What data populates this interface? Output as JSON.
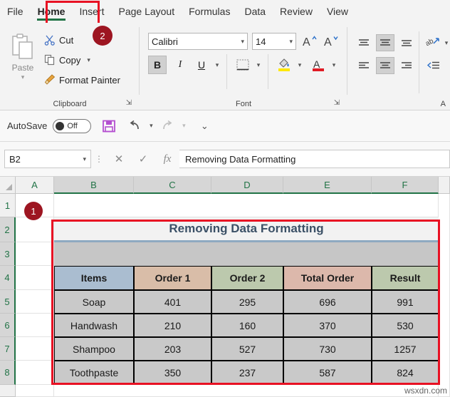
{
  "tabs": [
    {
      "label": "File",
      "active": false
    },
    {
      "label": "Home",
      "active": true
    },
    {
      "label": "Insert",
      "active": false
    },
    {
      "label": "Page Layout",
      "active": false
    },
    {
      "label": "Formulas",
      "active": false
    },
    {
      "label": "Data",
      "active": false
    },
    {
      "label": "Review",
      "active": false
    },
    {
      "label": "View",
      "active": false
    }
  ],
  "ribbon": {
    "clipboard": {
      "group_label": "Clipboard",
      "paste_label": "Paste",
      "items": [
        {
          "label": "Cut",
          "icon": "scissors-icon"
        },
        {
          "label": "Copy",
          "icon": "copy-icon"
        },
        {
          "label": "Format Painter",
          "icon": "paintbrush-icon"
        }
      ]
    },
    "font": {
      "group_label": "Font",
      "font_name": "Calibri",
      "font_size": "14",
      "bold_label": "B",
      "italic_label": "I",
      "underline_label": "U",
      "bold_active": true
    },
    "alignment": {
      "group_label": "A"
    }
  },
  "quick_access": {
    "autosave_label": "AutoSave",
    "autosave_state": "Off"
  },
  "formula_bar": {
    "name_box": "B2",
    "fx_label": "fx",
    "formula_value": "Removing Data Formatting"
  },
  "grid": {
    "columns": [
      "A",
      "B",
      "C",
      "D",
      "E",
      "F"
    ],
    "selected_columns": [
      "B",
      "C",
      "D",
      "E",
      "F"
    ],
    "rows": [
      "1",
      "2",
      "3",
      "4",
      "5",
      "6",
      "7",
      "8"
    ],
    "selected_rows": [
      "2",
      "3",
      "4",
      "5",
      "6",
      "7",
      "8"
    ]
  },
  "sheet_table": {
    "title": "Removing Data Formatting",
    "headers": [
      "Items",
      "Order 1",
      "Order 2",
      "Total Order",
      "Result"
    ],
    "header_colors": [
      "#aabdd0",
      "#d9bda8",
      "#bcc9ad",
      "#dcb8ab",
      "#bcc9ad"
    ],
    "rows": [
      [
        "Soap",
        "401",
        "295",
        "696",
        "991"
      ],
      [
        "Handwash",
        "210",
        "160",
        "370",
        "530"
      ],
      [
        "Shampoo",
        "203",
        "527",
        "730",
        "1257"
      ],
      [
        "Toothpaste",
        "350",
        "237",
        "587",
        "824"
      ]
    ]
  },
  "annotations": {
    "badge_1": "1",
    "badge_2": "2",
    "accent_color": "#e81123",
    "badge_color": "#9d1521"
  },
  "watermark": "wsxdn.com"
}
